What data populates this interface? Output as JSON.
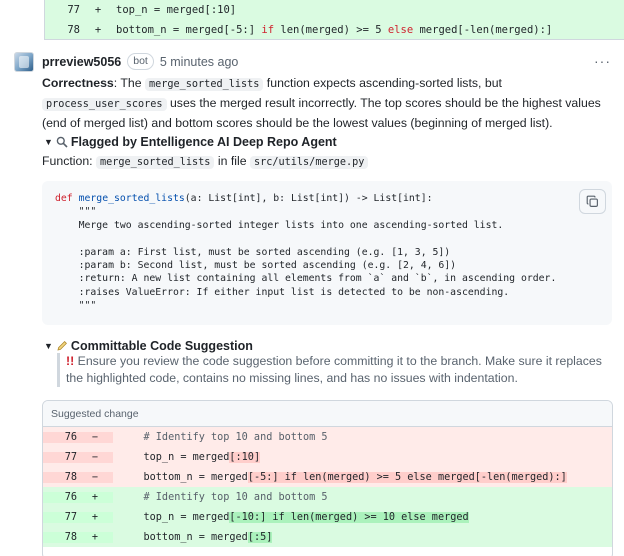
{
  "top_diff": [
    {
      "ln": "77",
      "sign": "+",
      "code": "top_n = merged[:10]"
    },
    {
      "ln": "78",
      "sign": "+",
      "code_pre": "bottom_n = merged[-5:] ",
      "kw_if": "if",
      "code_mid": " len(merged) >= 5 ",
      "kw_else": "else",
      "code_post": " merged[-len(merged):]"
    }
  ],
  "comment": {
    "author": "prreview5056",
    "badge": "bot",
    "time": "5 minutes ago",
    "menu": "···",
    "para": {
      "lead": "Correctness",
      "t1": ": The ",
      "c1": "merge_sorted_lists",
      "t2": " function expects ascending-sorted lists, but ",
      "c2": "process_user_scores",
      "t3": " uses the merged result incorrectly. The top scores should be the highest values (end of merged list) and bottom scores should be the lowest values (beginning of merged list)."
    },
    "flagged_title": "Flagged by Entelligence AI Deep Repo Agent",
    "function_label": "Function:",
    "function_name": "merge_sorted_lists",
    "in_file": "in file",
    "file_path": "src/utils/merge.py",
    "code_block": "def merge_sorted_lists(a: List[int], b: List[int]) -> List[int]:\n    \"\"\"\n    Merge two ascending-sorted integer lists into one ascending-sorted list.\n\n    :param a: First list, must be sorted ascending (e.g. [1, 3, 5])\n    :param b: Second list, must be sorted ascending (e.g. [2, 4, 6])\n    :return: A new list containing all elements from `a` and `b`, in ascending order.\n    :raises ValueError: If either input list is detected to be non-ascending.\n    \"\"\"",
    "suggestion_title": "Committable Code Suggestion",
    "notice_icon": "!!",
    "notice": "Ensure you review the code suggestion before committing it to the branch. Make sure it replaces the highlighted code, contains no missing lines, and has no issues with indentation.",
    "suggested_change_label": "Suggested change"
  },
  "suggestion_rows": [
    {
      "type": "del",
      "ln": "76",
      "sign": "−",
      "code": "    # Identify top 10 and bottom 5"
    },
    {
      "type": "del",
      "ln": "77",
      "sign": "−",
      "pre": "    top_n = merged",
      "hl": "[:10]",
      "post": ""
    },
    {
      "type": "del",
      "ln": "78",
      "sign": "−",
      "pre": "    bottom_n = merged",
      "hl": "[-5:] if len(merged) >= 5 else merged[-len(merged):]",
      "post": ""
    },
    {
      "type": "add",
      "ln": "76",
      "sign": "+",
      "code": "    # Identify top 10 and bottom 5"
    },
    {
      "type": "add",
      "ln": "77",
      "sign": "+",
      "pre": "    top_n = merged",
      "hl": "[-10:] if len(merged) >= 10 else merged",
      "post": ""
    },
    {
      "type": "add",
      "ln": "78",
      "sign": "+",
      "pre": "    bottom_n = merged",
      "hl": "[:5]",
      "post": ""
    }
  ]
}
